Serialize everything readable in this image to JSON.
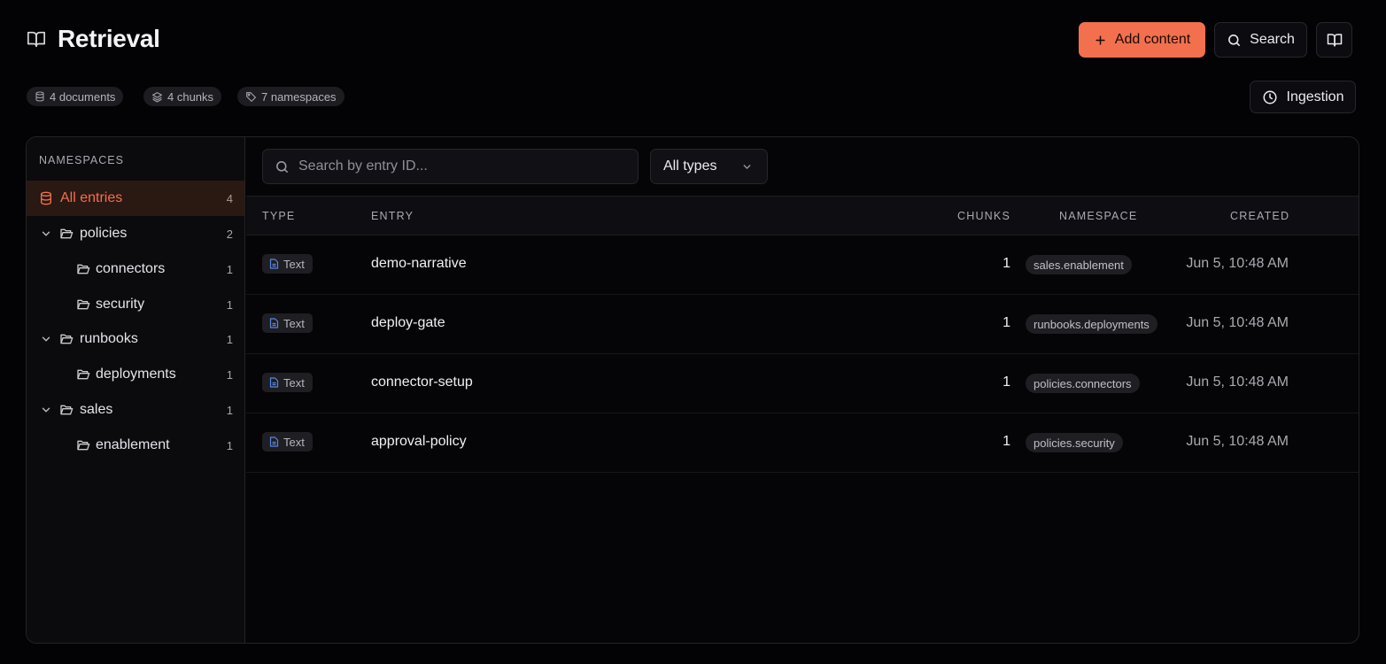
{
  "header": {
    "title": "Retrieval",
    "add_content_label": "Add content",
    "search_label": "Search",
    "ingestion_label": "Ingestion"
  },
  "stats": {
    "documents": "4 documents",
    "chunks": "4 chunks",
    "namespaces": "7 namespaces"
  },
  "sidebar": {
    "heading": "NAMESPACES",
    "all_entries": {
      "label": "All entries",
      "count": "4"
    },
    "items": [
      {
        "label": "policies",
        "count": "2"
      },
      {
        "label": "connectors",
        "count": "1"
      },
      {
        "label": "security",
        "count": "1"
      },
      {
        "label": "runbooks",
        "count": "1"
      },
      {
        "label": "deployments",
        "count": "1"
      },
      {
        "label": "sales",
        "count": "1"
      },
      {
        "label": "enablement",
        "count": "1"
      }
    ]
  },
  "toolbar": {
    "search_placeholder": "Search by entry ID...",
    "type_filter": "All types"
  },
  "table": {
    "columns": {
      "type": "TYPE",
      "entry": "ENTRY",
      "chunks": "CHUNKS",
      "namespace": "NAMESPACE",
      "created": "CREATED"
    },
    "rows": [
      {
        "type": "Text",
        "entry": "demo-narrative",
        "chunks": "1",
        "namespace": "sales.enablement",
        "created": "Jun 5, 10:48 AM"
      },
      {
        "type": "Text",
        "entry": "deploy-gate",
        "chunks": "1",
        "namespace": "runbooks.deployments",
        "created": "Jun 5, 10:48 AM"
      },
      {
        "type": "Text",
        "entry": "connector-setup",
        "chunks": "1",
        "namespace": "policies.connectors",
        "created": "Jun 5, 10:48 AM"
      },
      {
        "type": "Text",
        "entry": "approval-policy",
        "chunks": "1",
        "namespace": "policies.security",
        "created": "Jun 5, 10:48 AM"
      }
    ]
  },
  "colors": {
    "accent": "#f2704e",
    "background": "#030305",
    "file_icon": "#5b86e0"
  },
  "icons": {
    "title": "book-open-icon",
    "add": "plus-icon",
    "search": "search-icon",
    "docs": "book-open-icon",
    "ingestion": "clock-icon",
    "documents": "database-icon",
    "chunks": "layers-icon",
    "namespaces": "tag-icon",
    "folder": "folder-open-icon",
    "type": "file-text-icon"
  }
}
